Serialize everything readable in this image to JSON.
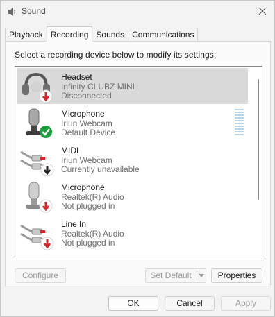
{
  "window": {
    "title": "Sound",
    "icon": "speaker-icon"
  },
  "tabs": [
    {
      "label": "Playback",
      "active": false
    },
    {
      "label": "Recording",
      "active": true
    },
    {
      "label": "Sounds",
      "active": false
    },
    {
      "label": "Communications",
      "active": false
    }
  ],
  "instructions": "Select a recording device below to modify its settings:",
  "devices": [
    {
      "name": "Headset",
      "line1": "Infinity CLUBZ MINI",
      "line2": "Disconnected",
      "icon": "headset-icon",
      "status": "red-down-arrow",
      "selected": true
    },
    {
      "name": "Microphone",
      "line1": "Iriun Webcam",
      "line2": "Default Device",
      "icon": "microphone-icon",
      "status": "green-check",
      "selected": false
    },
    {
      "name": "MIDI",
      "line1": "Iriun Webcam",
      "line2": "Currently unavailable",
      "icon": "line-in-cable-icon",
      "status": "black-down-arrow",
      "selected": false
    },
    {
      "name": "Microphone",
      "line1": "Realtek(R) Audio",
      "line2": "Not plugged in",
      "icon": "microphone-icon",
      "status": "red-down-arrow",
      "selected": false
    },
    {
      "name": "Line In",
      "line1": "Realtek(R) Audio",
      "line2": "Not plugged in",
      "icon": "line-in-cable-icon",
      "status": "red-down-arrow",
      "selected": false
    }
  ],
  "buttons": {
    "configure": "Configure",
    "set_default": "Set Default",
    "properties": "Properties",
    "ok": "OK",
    "cancel": "Cancel",
    "apply": "Apply"
  },
  "colors": {
    "selection": "#dadada",
    "status_red": "#d9262b",
    "status_green": "#1a9d3a",
    "level_meter": "#bcd6e4"
  }
}
